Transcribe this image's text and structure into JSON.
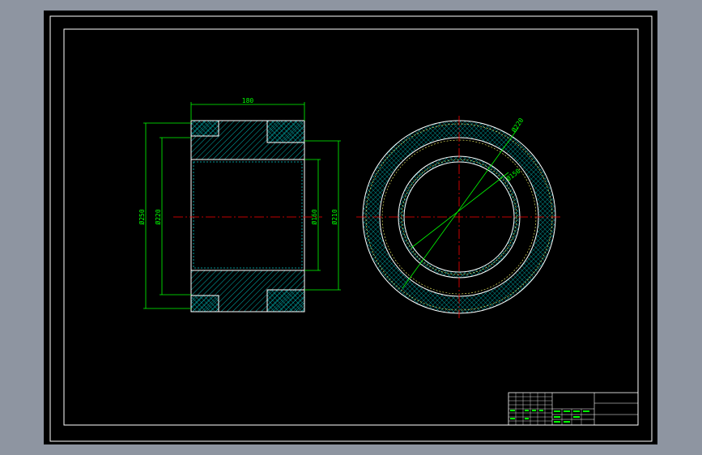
{
  "drawing": {
    "dimensions": {
      "length": "180",
      "outer_diameter": "Ø250",
      "inner_step_diameter": "Ø220",
      "bore_diameter": "Ø160",
      "groove_diameter": "Ø210"
    },
    "end_view": {
      "outer_label": "Ø220",
      "inner_label": "Ø150"
    }
  },
  "colors": {
    "background": "#000000",
    "frame": "#ffffff",
    "part": "#ffffff",
    "hatch": "#00c8c8",
    "dimension": "#00ff00",
    "centerline": "#ff0000",
    "title_text": "#00ff00"
  },
  "icons": {
    "section_hatch": "crosshatch-pattern",
    "diagonal_hatch": "diagonal-hatch-pattern"
  }
}
